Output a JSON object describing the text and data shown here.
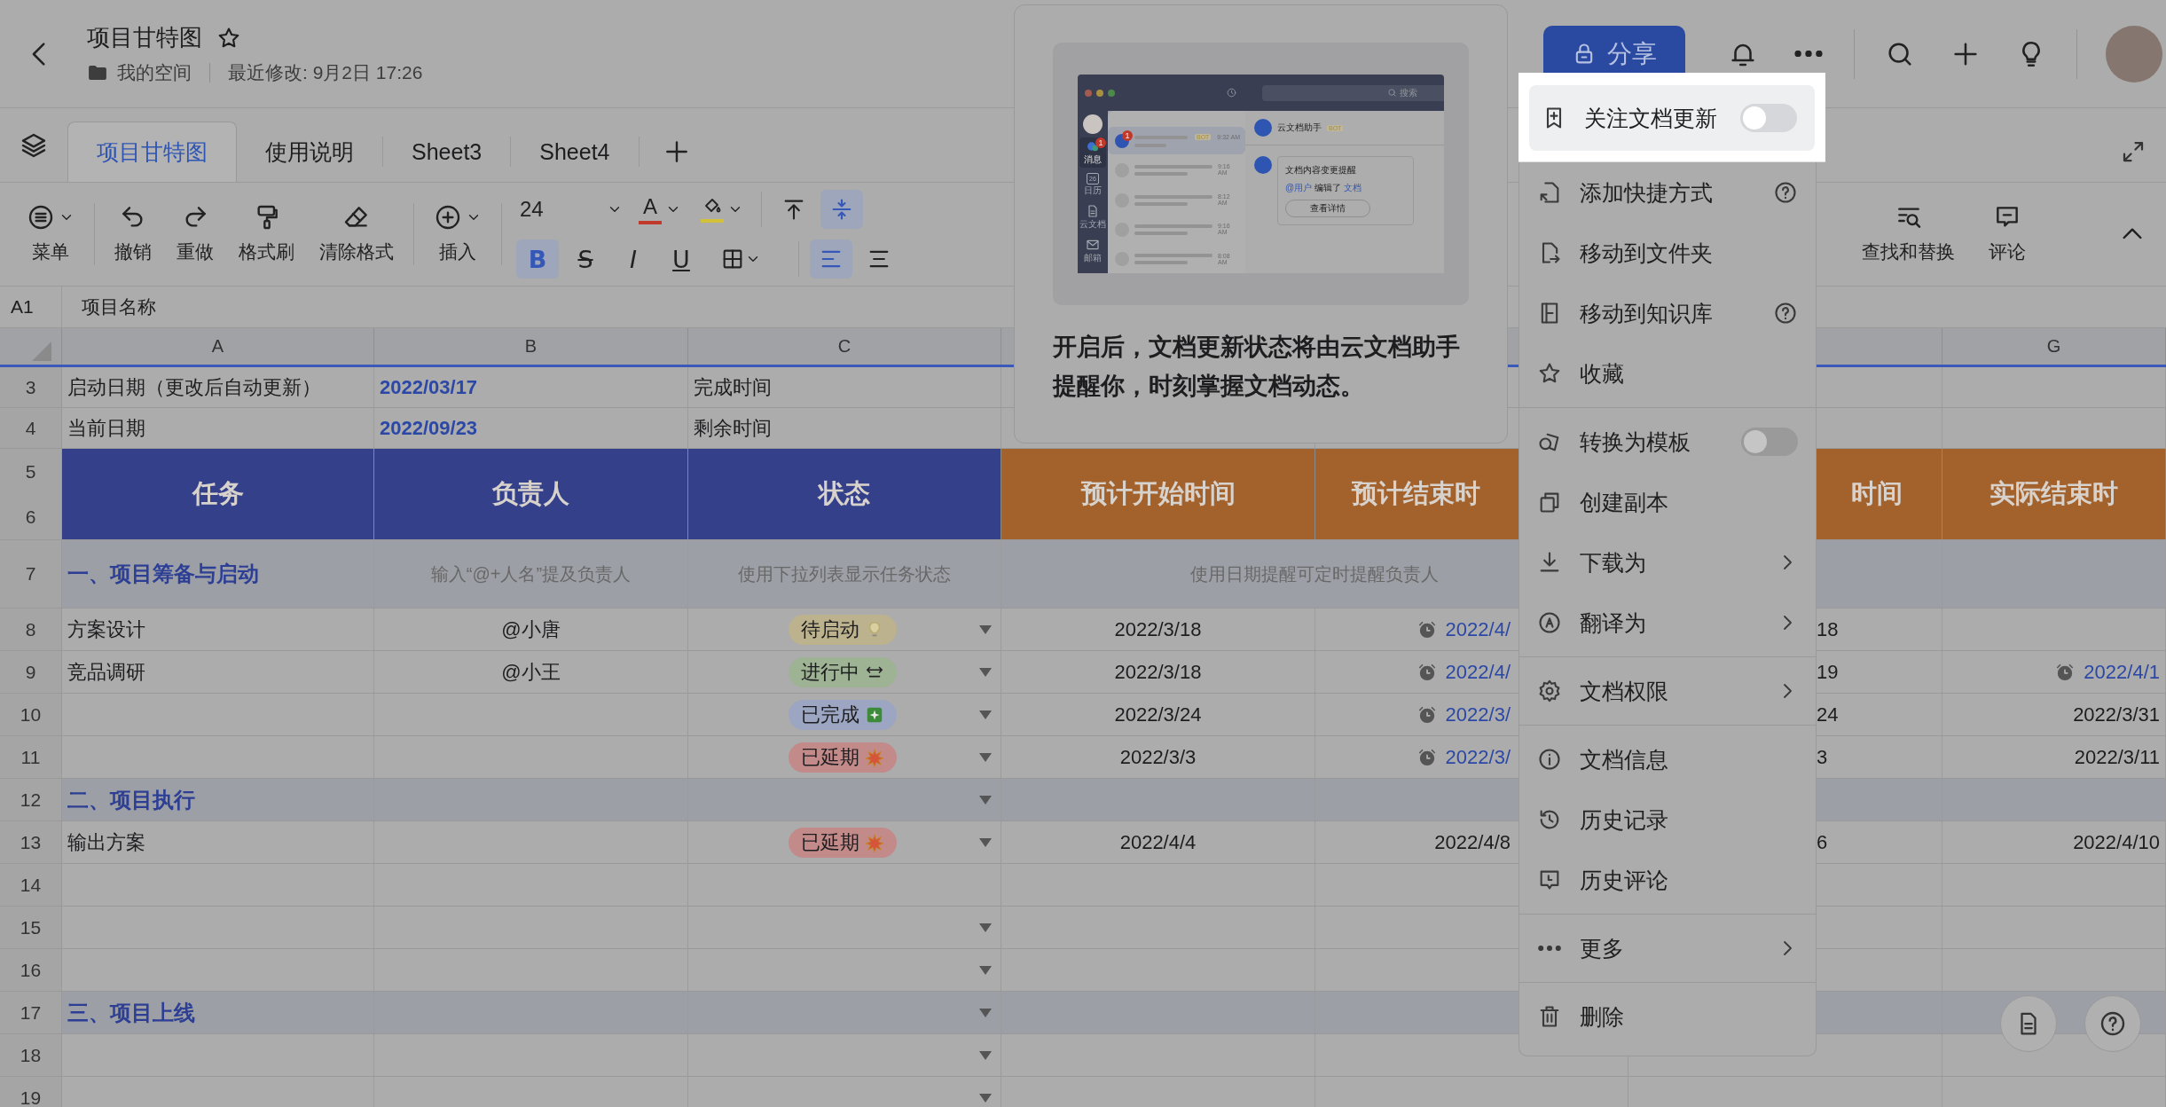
{
  "header": {
    "title": "项目甘特图",
    "location": "我的空间",
    "modified": "最近修改: 9月2日 17:26",
    "share": "分享"
  },
  "tabs": [
    {
      "label": "项目甘特图",
      "selected": true
    },
    {
      "label": "使用说明",
      "selected": false
    },
    {
      "label": "Sheet3",
      "selected": false
    },
    {
      "label": "Sheet4",
      "selected": false
    }
  ],
  "toolbar": {
    "left": [
      {
        "label": "菜单",
        "caret": true
      },
      {
        "label": "撤销",
        "caret": false
      },
      {
        "label": "重做",
        "caret": false
      },
      {
        "label": "格式刷",
        "caret": false
      },
      {
        "label": "清除格式",
        "caret": false
      },
      {
        "label": "插入",
        "caret": true
      }
    ],
    "font_size": "24",
    "font_color": {
      "label": "A",
      "color": "#c0392b"
    },
    "fill_color": {
      "color": "#d4c13a"
    },
    "top": [
      {
        "kind": "align-top",
        "selected": false
      },
      {
        "kind": "align-middle",
        "selected": true
      }
    ],
    "bottom": [
      {
        "kind": "bold",
        "label": "B",
        "selected": true
      },
      {
        "kind": "strike",
        "label": "S",
        "selected": false
      },
      {
        "kind": "italic",
        "label": "I",
        "selected": false
      },
      {
        "kind": "underline",
        "label": "U",
        "selected": false
      },
      {
        "kind": "borders",
        "selected": false
      },
      {
        "kind": "align-left",
        "selected": true
      },
      {
        "kind": "align-center",
        "selected": false
      }
    ],
    "right": [
      {
        "label": "查找和替换"
      },
      {
        "label": "评论"
      }
    ]
  },
  "formula_bar": {
    "cell": "A1",
    "value": "项目名称"
  },
  "columns": [
    {
      "label": "A"
    },
    {
      "label": "B"
    },
    {
      "label": "C"
    },
    {},
    {},
    {},
    {
      "label": "G"
    }
  ],
  "rows": [
    {
      "numbers": [
        "3"
      ],
      "kind": "info",
      "cells": [
        {
          "text": "启动日期（更改后自动更新）"
        },
        {
          "text": "2022/03/17"
        },
        {
          "text": "完成时间"
        },
        {},
        {},
        {},
        {}
      ]
    },
    {
      "numbers": [
        "4"
      ],
      "kind": "info",
      "cells": [
        {
          "text": "当前日期"
        },
        {
          "text": "2022/09/23"
        },
        {
          "text": "剩余时间"
        },
        {},
        {},
        {},
        {}
      ]
    },
    {
      "numbers": [
        "5",
        "6"
      ],
      "kind": "header",
      "cells": [
        {
          "text": "任务",
          "color": "#34418a"
        },
        {
          "text": "负责人",
          "color": "#34418a"
        },
        {
          "text": "状态",
          "color": "#34418a"
        },
        {
          "text": "预计开始时间",
          "color": "#a3612c"
        },
        {
          "text": "预计结束时",
          "color": "#a3612c"
        },
        {
          "text": "时间",
          "color": "#a3612c"
        },
        {
          "text": "实际结束时",
          "color": "#a3612c"
        }
      ]
    },
    {
      "numbers": [
        "7"
      ],
      "kind": "hint",
      "cells": [
        {
          "text": "一、项目筹备与启动"
        },
        {
          "text": "输入“@+人名”提及负责人"
        },
        {
          "text": "使用下拉列表显示任务状态"
        },
        {
          "text": "使用日期提醒可定时提醒负责人",
          "merged": true
        },
        {},
        {}
      ]
    },
    {
      "numbers": [
        "8"
      ],
      "kind": "task",
      "dropdown": true,
      "cells": [
        {
          "text": "方案设计"
        },
        {
          "text": "@小唐"
        },
        {
          "status": {
            "text": "待启动",
            "kind": "idle",
            "color": "#bdb28e"
          }
        },
        {
          "text": "2022/3/18"
        },
        {
          "text": "2022/4/",
          "alarm": true
        },
        {
          "text": "18"
        },
        {}
      ]
    },
    {
      "numbers": [
        "9"
      ],
      "kind": "task",
      "dropdown": true,
      "cells": [
        {
          "text": "竞品调研"
        },
        {
          "text": "@小王"
        },
        {
          "status": {
            "text": "进行中",
            "kind": "progress",
            "color": "#9db393"
          }
        },
        {
          "text": "2022/3/18"
        },
        {
          "text": "2022/4/",
          "alarm": true
        },
        {
          "text": "19"
        },
        {
          "text": "2022/4/1",
          "alarm": true
        }
      ]
    },
    {
      "numbers": [
        "10"
      ],
      "kind": "task",
      "dropdown": true,
      "cells": [
        {},
        {},
        {
          "status": {
            "text": "已完成",
            "kind": "done",
            "color": "#9ca6c2"
          }
        },
        {
          "text": "2022/3/24"
        },
        {
          "text": "2022/3/",
          "alarm": true
        },
        {
          "text": "24"
        },
        {
          "text": "2022/3/31"
        }
      ]
    },
    {
      "numbers": [
        "11"
      ],
      "kind": "task",
      "dropdown": true,
      "cells": [
        {},
        {},
        {
          "status": {
            "text": "已延期",
            "kind": "delayed",
            "color": "#c38a8a"
          }
        },
        {
          "text": "2022/3/3"
        },
        {
          "text": "2022/3/",
          "alarm": true
        },
        {
          "text": "3"
        },
        {
          "text": "2022/3/11"
        }
      ]
    },
    {
      "numbers": [
        "12"
      ],
      "kind": "section",
      "dropdown": true,
      "cells": [
        {
          "text": "二、项目执行"
        },
        {},
        {},
        {},
        {},
        {},
        {}
      ]
    },
    {
      "numbers": [
        "13"
      ],
      "kind": "task",
      "dropdown": true,
      "cells": [
        {
          "text": "输出方案"
        },
        {},
        {
          "status": {
            "text": "已延期",
            "kind": "delayed",
            "color": "#c38a8a"
          }
        },
        {
          "text": "2022/4/4"
        },
        {
          "text": "2022/4/8"
        },
        {
          "text": "6"
        },
        {
          "text": "2022/4/10"
        }
      ]
    },
    {
      "numbers": [
        "14"
      ],
      "kind": "blank",
      "dropdown": false,
      "cells": [
        {},
        {},
        {},
        {},
        {},
        {},
        {}
      ]
    },
    {
      "numbers": [
        "15"
      ],
      "kind": "blank",
      "dropdown": true,
      "cells": [
        {},
        {},
        {},
        {},
        {},
        {},
        {}
      ]
    },
    {
      "numbers": [
        "16"
      ],
      "kind": "blank",
      "dropdown": true,
      "cells": [
        {},
        {},
        {},
        {},
        {},
        {},
        {}
      ]
    },
    {
      "numbers": [
        "17"
      ],
      "kind": "section",
      "dropdown": true,
      "cells": [
        {
          "text": "三、项目上线"
        },
        {},
        {},
        {},
        {},
        {},
        {}
      ]
    },
    {
      "numbers": [
        "18"
      ],
      "kind": "blank",
      "dropdown": true,
      "cells": [
        {},
        {},
        {},
        {},
        {},
        {},
        {}
      ]
    },
    {
      "numbers": [
        "19"
      ],
      "kind": "blank",
      "dropdown": true,
      "cells": [
        {},
        {},
        {},
        {},
        {},
        {},
        {}
      ]
    }
  ],
  "popup": {
    "preview": {
      "search_placeholder": "搜索",
      "nav": [
        {
          "label": "消息",
          "selected": true,
          "badge": "1"
        },
        {
          "label": "日历",
          "selected": false,
          "day": "26"
        },
        {
          "label": "云文档",
          "selected": false
        },
        {
          "label": "邮箱",
          "selected": false
        }
      ],
      "chats": [
        {
          "time": "9:32 AM",
          "tag": "BOT",
          "badge": "1",
          "selected": true
        },
        {
          "time": "9:16 AM",
          "selected": false
        },
        {
          "time": "8:12 AM",
          "selected": false
        },
        {
          "time": "9:16 AM",
          "selected": false
        },
        {
          "time": "8:08 AM",
          "selected": false
        }
      ],
      "chat_title": "云文档助手",
      "chat_tag": "BOT",
      "card": {
        "title": "文档内容变更提醒",
        "mention": "@用户",
        "action": "编辑了",
        "link": "文档",
        "button": "查看详情"
      }
    },
    "caption": "开启后，文档更新状态将由云文档助手提醒你，时刻掌握文档动态。"
  },
  "menu": {
    "groups": [
      [
        {
          "label": "关注文档更新",
          "kind": "toggle",
          "on": false
        }
      ],
      [
        {
          "label": "添加快捷方式",
          "kind": "help"
        },
        {
          "label": "移动到文件夹",
          "kind": "plain"
        },
        {
          "label": "移动到知识库",
          "kind": "help"
        },
        {
          "label": "收藏",
          "kind": "plain"
        }
      ],
      [
        {
          "label": "转换为模板",
          "kind": "toggle",
          "on": false
        },
        {
          "label": "创建副本",
          "kind": "plain"
        },
        {
          "label": "下载为",
          "kind": "submenu"
        },
        {
          "label": "翻译为",
          "kind": "submenu"
        }
      ],
      [
        {
          "label": "文档权限",
          "kind": "submenu"
        }
      ],
      [
        {
          "label": "文档信息",
          "kind": "plain"
        },
        {
          "label": "历史记录",
          "kind": "plain"
        },
        {
          "label": "历史评论",
          "kind": "plain"
        }
      ],
      [
        {
          "label": "更多",
          "kind": "submenu"
        }
      ],
      [
        {
          "label": "删除",
          "kind": "plain"
        }
      ]
    ]
  }
}
